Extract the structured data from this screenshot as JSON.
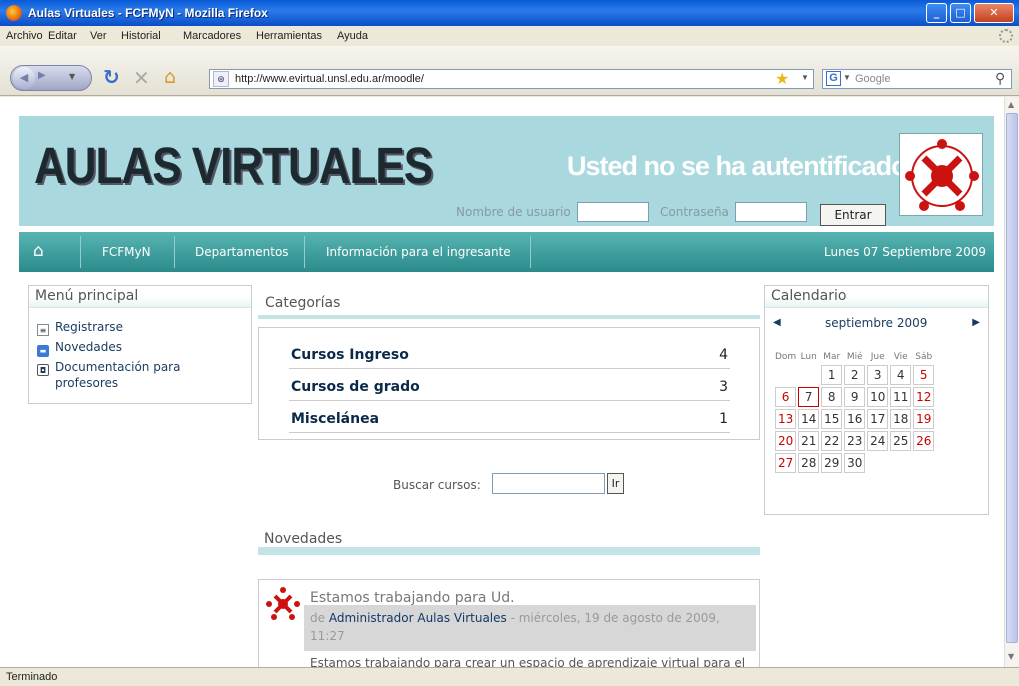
{
  "window": {
    "title": "Aulas Virtuales - FCFMyN - Mozilla Firefox"
  },
  "menu": [
    "Archivo",
    "Editar",
    "Ver",
    "Historial",
    "Marcadores",
    "Herramientas",
    "Ayuda"
  ],
  "toolbar": {
    "url": "http://www.evirtual.unsl.edu.ar/moodle/",
    "search_placeholder": "Google"
  },
  "header": {
    "logo_text": "AULAS VIRTUALES",
    "not_authenticated": "Usted no se ha autentificado.",
    "username_label": "Nombre de usuario",
    "password_label": "Contraseña",
    "login_button": "Entrar"
  },
  "nav": {
    "items": [
      "FCFMyN",
      "Departamentos",
      "Información para el ingresante"
    ],
    "date": "Lunes 07 Septiembre 2009"
  },
  "main_menu": {
    "title": "Menú principal",
    "items": [
      {
        "label": "Registrarse",
        "icon": "document-icon"
      },
      {
        "label": "Novedades",
        "icon": "chat-icon"
      },
      {
        "label": "Documentación para",
        "label2": "profesores",
        "icon": "docs-icon"
      }
    ]
  },
  "categories": {
    "title": "Categorías",
    "rows": [
      {
        "name": "Cursos Ingreso",
        "count": "4"
      },
      {
        "name": "Cursos de grado",
        "count": "3"
      },
      {
        "name": "Miscelánea",
        "count": "1"
      }
    ]
  },
  "course_search": {
    "label": "Buscar cursos:",
    "button": "Ir"
  },
  "news": {
    "title": "Novedades",
    "post": {
      "title": "Estamos trabajando para Ud.",
      "by": "de",
      "author": "Administrador Aulas Virtuales",
      "date": " - miércoles, 19 de agosto de 2009, 11:27",
      "body": "Estamos trabajando para crear un espacio de aprendizaje virtual para el"
    }
  },
  "calendar": {
    "title": "Calendario",
    "month": "septiembre 2009",
    "days": [
      "Dom",
      "Lun",
      "Mar",
      "Mié",
      "Jue",
      "Vie",
      "Sáb"
    ],
    "weeks": [
      [
        "",
        "",
        "1",
        "2",
        "3",
        "4",
        "5"
      ],
      [
        "6",
        "7",
        "8",
        "9",
        "10",
        "11",
        "12"
      ],
      [
        "13",
        "14",
        "15",
        "16",
        "17",
        "18",
        "19"
      ],
      [
        "20",
        "21",
        "22",
        "23",
        "24",
        "25",
        "26"
      ],
      [
        "27",
        "28",
        "29",
        "30",
        "",
        "",
        ""
      ]
    ],
    "today": "7"
  },
  "status": "Terminado"
}
